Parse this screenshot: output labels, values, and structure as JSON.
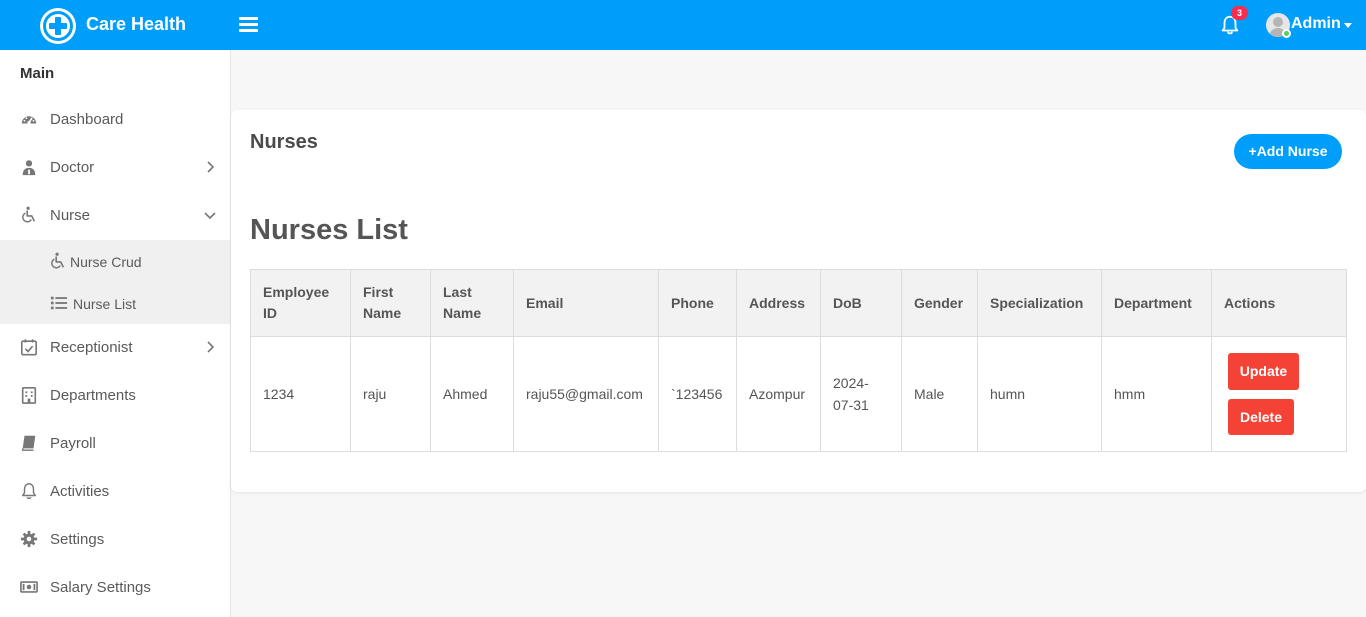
{
  "app": {
    "brand": "Care Health"
  },
  "header": {
    "notification_count": "3",
    "user_name": "Admin",
    "icons": [
      "menu-icon",
      "bell-icon",
      "avatar"
    ]
  },
  "sidebar": {
    "section_title": "Main",
    "items": [
      {
        "label": "Dashboard",
        "icon": "dashboard-icon"
      },
      {
        "label": "Doctor",
        "icon": "doctor-icon",
        "arrow": "chevron-right"
      },
      {
        "label": "Nurse",
        "icon": "wheelchair-icon",
        "arrow": "chevron-down"
      },
      {
        "label": "Receptionist",
        "icon": "calendar-check-icon",
        "arrow": "chevron-right"
      },
      {
        "label": "Departments",
        "icon": "hospital-icon"
      },
      {
        "label": "Payroll",
        "icon": "book-icon"
      },
      {
        "label": "Activities",
        "icon": "bell-icon"
      },
      {
        "label": "Settings",
        "icon": "gear-icon"
      },
      {
        "label": "Salary Settings",
        "icon": "money-icon"
      }
    ],
    "nurse_submenu": [
      {
        "label": "Nurse Crud",
        "icon": "wheelchair-icon"
      },
      {
        "label": "Nurse List",
        "icon": "list-icon"
      }
    ]
  },
  "main": {
    "page_title": "Nurses",
    "add_button": "+Add Nurse",
    "list_title": "Nurses List",
    "table": {
      "headers": [
        "Employee ID",
        "First Name",
        "Last Name",
        "Email",
        "Phone",
        "Address",
        "DoB",
        "Gender",
        "Specialization",
        "Department",
        "Actions"
      ],
      "rows": [
        {
          "employee_id": "1234",
          "first_name": "raju",
          "last_name": "Ahmed",
          "email": "raju55@gmail.com",
          "phone": "`123456",
          "address": "Azompur",
          "dob": "2024-07-31",
          "gender": "Male",
          "specialization": "humn",
          "department": "hmm",
          "update_label": "Update",
          "delete_label": "Delete"
        }
      ]
    }
  },
  "colors": {
    "primary": "#009efb",
    "danger": "#f44336",
    "badge": "#f62d51",
    "online": "#55ce63"
  }
}
